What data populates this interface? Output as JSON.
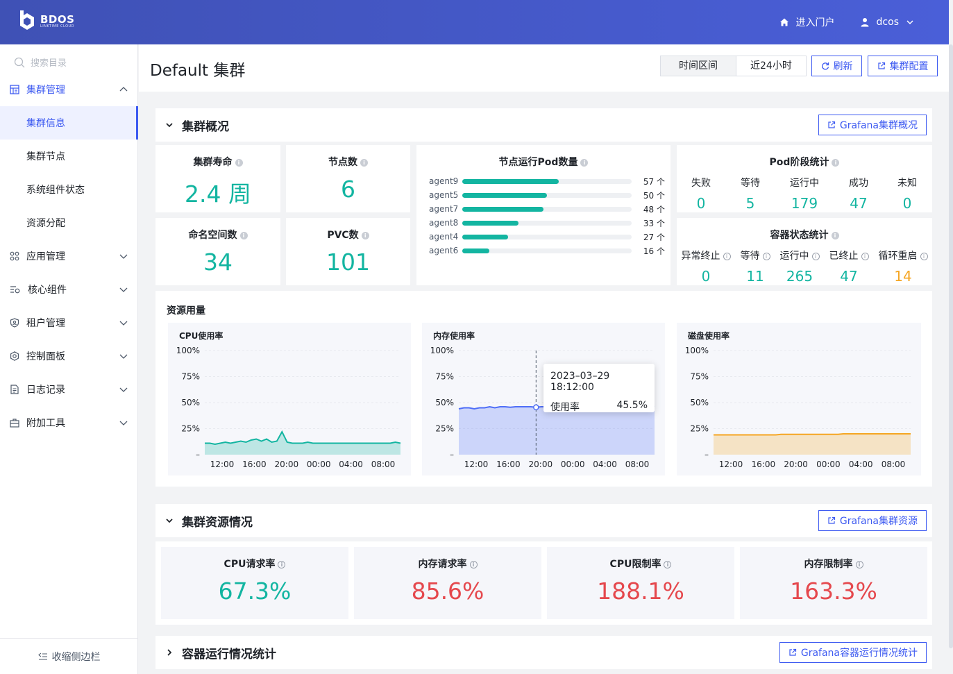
{
  "header": {
    "logo_text": "BDOS",
    "logo_sub": "LINKTIME CLOUD",
    "portal_label": "进入门户",
    "user_label": "dcos"
  },
  "sidebar": {
    "search_placeholder": "搜索目录",
    "items": [
      {
        "label": "集群管理",
        "icon": "cluster-icon",
        "expanded": true
      },
      {
        "label": "应用管理",
        "icon": "apps-icon"
      },
      {
        "label": "核心组件",
        "icon": "components-icon"
      },
      {
        "label": "租户管理",
        "icon": "shield-icon"
      },
      {
        "label": "控制面板",
        "icon": "gear-icon"
      },
      {
        "label": "日志记录",
        "icon": "document-icon"
      },
      {
        "label": "附加工具",
        "icon": "toolbox-icon"
      }
    ],
    "sub_items": [
      "集群信息",
      "集群节点",
      "系统组件状态",
      "资源分配"
    ],
    "collapse_label": "收缩侧边栏"
  },
  "page": {
    "title": "Default 集群",
    "range_label": "时间区间",
    "range_value": "近24小时",
    "refresh_label": "刷新",
    "config_label": "集群配置"
  },
  "overview": {
    "title": "集群概况",
    "grafana_label": "Grafana集群概况",
    "stats": {
      "age": {
        "title": "集群寿命",
        "value": "2.4 周"
      },
      "nodes": {
        "title": "节点数",
        "value": "6"
      },
      "namespaces": {
        "title": "命名空间数",
        "value": "34"
      },
      "pvc": {
        "title": "PVC数",
        "value": "101"
      }
    },
    "pod_per_node": {
      "title": "节点运行Pod数量",
      "rows": [
        {
          "name": "agent9",
          "value": 57,
          "label": "57 个"
        },
        {
          "name": "agent5",
          "value": 50,
          "label": "50 个"
        },
        {
          "name": "agent7",
          "value": 48,
          "label": "48 个"
        },
        {
          "name": "agent8",
          "value": 33,
          "label": "33 个"
        },
        {
          "name": "agent4",
          "value": 27,
          "label": "27 个"
        },
        {
          "name": "agent6",
          "value": 16,
          "label": "16 个"
        }
      ]
    },
    "pod_phase": {
      "title": "Pod阶段统计",
      "cells": [
        {
          "label": "失败",
          "value": "0"
        },
        {
          "label": "等待",
          "value": "5"
        },
        {
          "label": "运行中",
          "value": "179"
        },
        {
          "label": "成功",
          "value": "47"
        },
        {
          "label": "未知",
          "value": "0"
        }
      ]
    },
    "container_state": {
      "title": "容器状态统计",
      "cells": [
        {
          "label": "异常终止",
          "value": "0"
        },
        {
          "label": "等待",
          "value": "11"
        },
        {
          "label": "运行中",
          "value": "265"
        },
        {
          "label": "已终止",
          "value": "47"
        },
        {
          "label": "循环重启",
          "value": "14"
        }
      ]
    }
  },
  "usage": {
    "title": "资源用量"
  },
  "chart_data": [
    {
      "type": "area",
      "title": "CPU使用率",
      "yticks": [
        "100%",
        "75%",
        "50%",
        "25%",
        "–"
      ],
      "xticks": [
        "12:00",
        "16:00",
        "20:00",
        "00:00",
        "04:00",
        "08:00"
      ],
      "ylim": [
        0,
        100
      ],
      "color": "#13b5a1",
      "values": [
        11,
        11,
        10,
        11,
        12,
        11,
        12,
        13,
        12,
        14,
        15,
        13,
        15,
        12,
        13,
        22,
        12,
        11,
        11,
        11,
        12,
        11,
        11,
        11,
        11,
        11,
        11,
        11,
        11,
        11,
        11,
        11,
        11,
        11,
        11,
        11,
        11,
        12,
        11
      ]
    },
    {
      "type": "area",
      "title": "内存使用率",
      "yticks": [
        "100%",
        "75%",
        "50%",
        "25%",
        "–"
      ],
      "xticks": [
        "12:00",
        "16:00",
        "20:00",
        "00:00",
        "04:00",
        "08:00"
      ],
      "ylim": [
        0,
        100
      ],
      "color": "#4f6ef7",
      "values": [
        44,
        45,
        45,
        44,
        45,
        45,
        46,
        45,
        46,
        46,
        45.5,
        46,
        46,
        46,
        46,
        45.5,
        46,
        46,
        46,
        46,
        46,
        46,
        46,
        46,
        46,
        46,
        46,
        46,
        46,
        46,
        46,
        46,
        46,
        46,
        46,
        46,
        46,
        46,
        47
      ],
      "tooltip": {
        "time": "2023–03–29 18:12:00",
        "label": "使用率",
        "value": "45.5%"
      }
    },
    {
      "type": "area",
      "title": "磁盘使用率",
      "yticks": [
        "100%",
        "75%",
        "50%",
        "25%",
        "–"
      ],
      "xticks": [
        "12:00",
        "16:00",
        "20:00",
        "00:00",
        "04:00",
        "08:00"
      ],
      "ylim": [
        0,
        100
      ],
      "color": "#f5a623",
      "values": [
        19,
        19,
        19,
        19,
        19,
        19,
        19,
        19,
        19,
        19,
        19,
        19,
        19,
        19.5,
        19.5,
        19.5,
        19.5,
        19.5,
        19.5,
        19.5,
        19.5,
        19.5,
        19.5,
        19.5,
        19.5,
        20,
        20,
        20,
        20,
        20,
        20,
        20,
        20,
        20,
        20,
        20,
        20,
        20,
        20
      ]
    }
  ],
  "resources": {
    "title": "集群资源情况",
    "grafana_label": "Grafana集群资源",
    "cards": [
      {
        "title": "CPU请求率",
        "value": "67.3%",
        "color": "#13b5a1"
      },
      {
        "title": "内存请求率",
        "value": "85.6%",
        "color": "#e5484d"
      },
      {
        "title": "CPU限制率",
        "value": "188.1%",
        "color": "#e5484d"
      },
      {
        "title": "内存限制率",
        "value": "163.3%",
        "color": "#e5484d"
      }
    ]
  },
  "containers": {
    "title": "容器运行情况统计",
    "grafana_label": "Grafana容器运行情况统计"
  },
  "colors": {
    "accent": "#3d5af1",
    "teal": "#13b5a1",
    "red": "#e5484d",
    "orange": "#f5a623"
  }
}
